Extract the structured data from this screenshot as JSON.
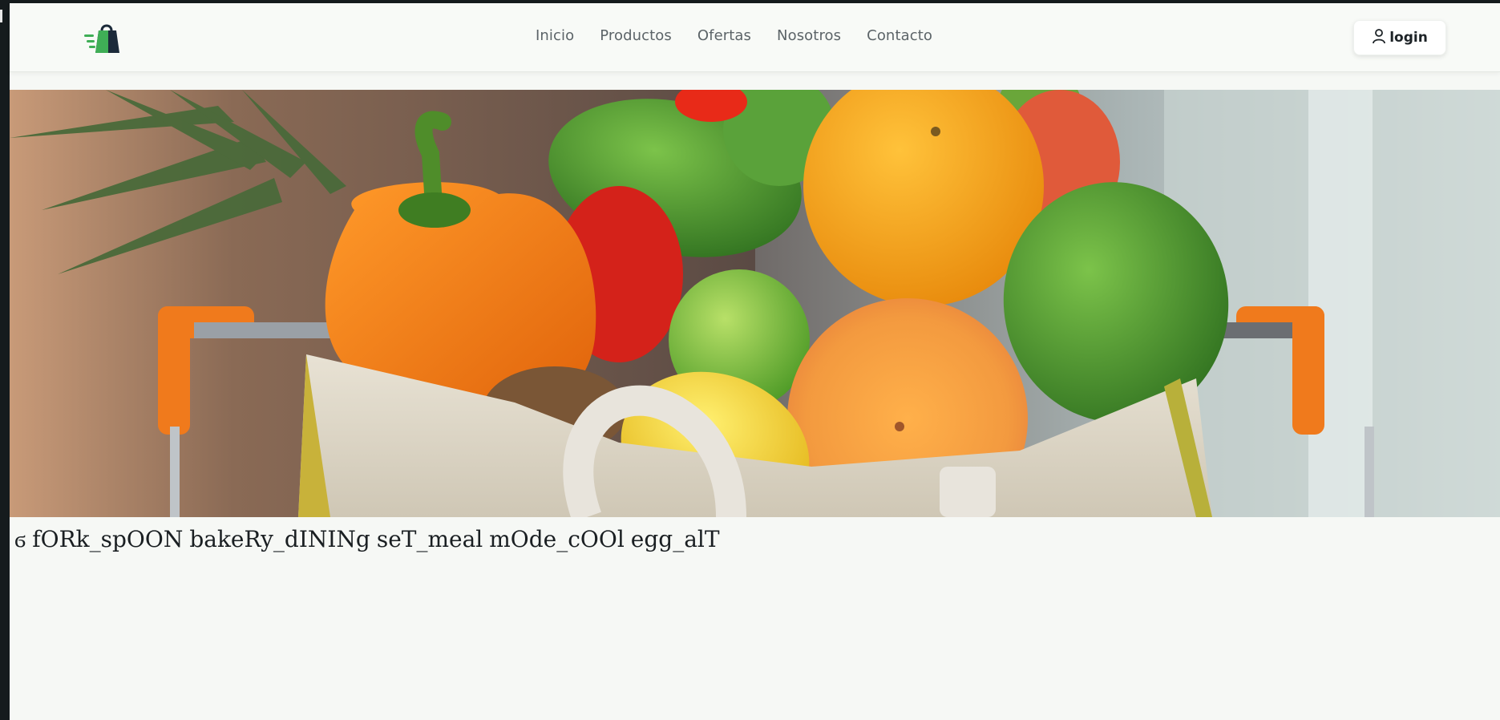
{
  "nav": {
    "links": [
      "Inicio",
      "Productos",
      "Ofertas",
      "Nosotros",
      "Contacto"
    ],
    "login_label": "login"
  },
  "icon_row": {
    "leading_glyph": "ϭ",
    "ligature_texts": [
      "fORk_spOON",
      "bakeRy_dININg",
      "seT_meal",
      "mOde_cOOl",
      "egg_alT"
    ]
  },
  "colors": {
    "background": "#f6f8f5",
    "nav_text": "#5c6468",
    "brand_green": "#4caf50",
    "brand_navy": "#1c2a3a"
  },
  "hero": {
    "image_name": "produce-bag-in-shopping-cart"
  }
}
